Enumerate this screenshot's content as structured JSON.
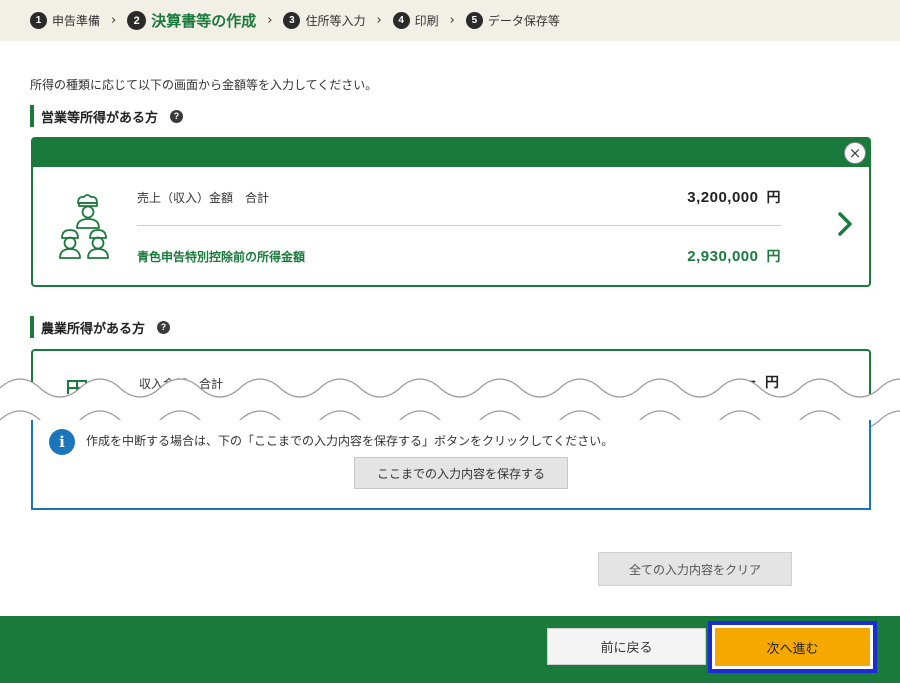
{
  "stepper": {
    "steps": [
      {
        "num": "1",
        "label": "申告準備"
      },
      {
        "num": "2",
        "label": "決算書等の作成"
      },
      {
        "num": "3",
        "label": "住所等入力"
      },
      {
        "num": "4",
        "label": "印刷"
      },
      {
        "num": "5",
        "label": "データ保存等"
      }
    ],
    "separator": "›"
  },
  "intro": "所得の種類に応じて以下の画面から金額等を入力してください。",
  "business": {
    "title": "営業等所得がある方",
    "help": "?",
    "close": "×",
    "rows": [
      {
        "label": "売上（収入）金額　合計",
        "value": "3,200,000",
        "unit": "円"
      },
      {
        "label": "青色申告特別控除前の所得金額",
        "value": "2,930,000",
        "unit": "円"
      }
    ]
  },
  "farm": {
    "title": "農業所得がある方",
    "help": "?",
    "row_label": "収入金額　合計",
    "row_value": "－",
    "row_unit": "円"
  },
  "info": {
    "icon": "i",
    "text": "作成を中断する場合は、下の「ここまでの入力内容を保存する」ボタンをクリックしてください。",
    "save_label": "ここまでの入力内容を保存する"
  },
  "clear_label": "全ての入力内容をクリア",
  "footer": {
    "back_label": "前に戻る",
    "next_label": "次へ進む"
  },
  "colors": {
    "brand_green": "#1a7a3c",
    "info_blue": "#1b75bb",
    "next_orange": "#f5a800",
    "focus_blue": "#1c2bd6"
  }
}
